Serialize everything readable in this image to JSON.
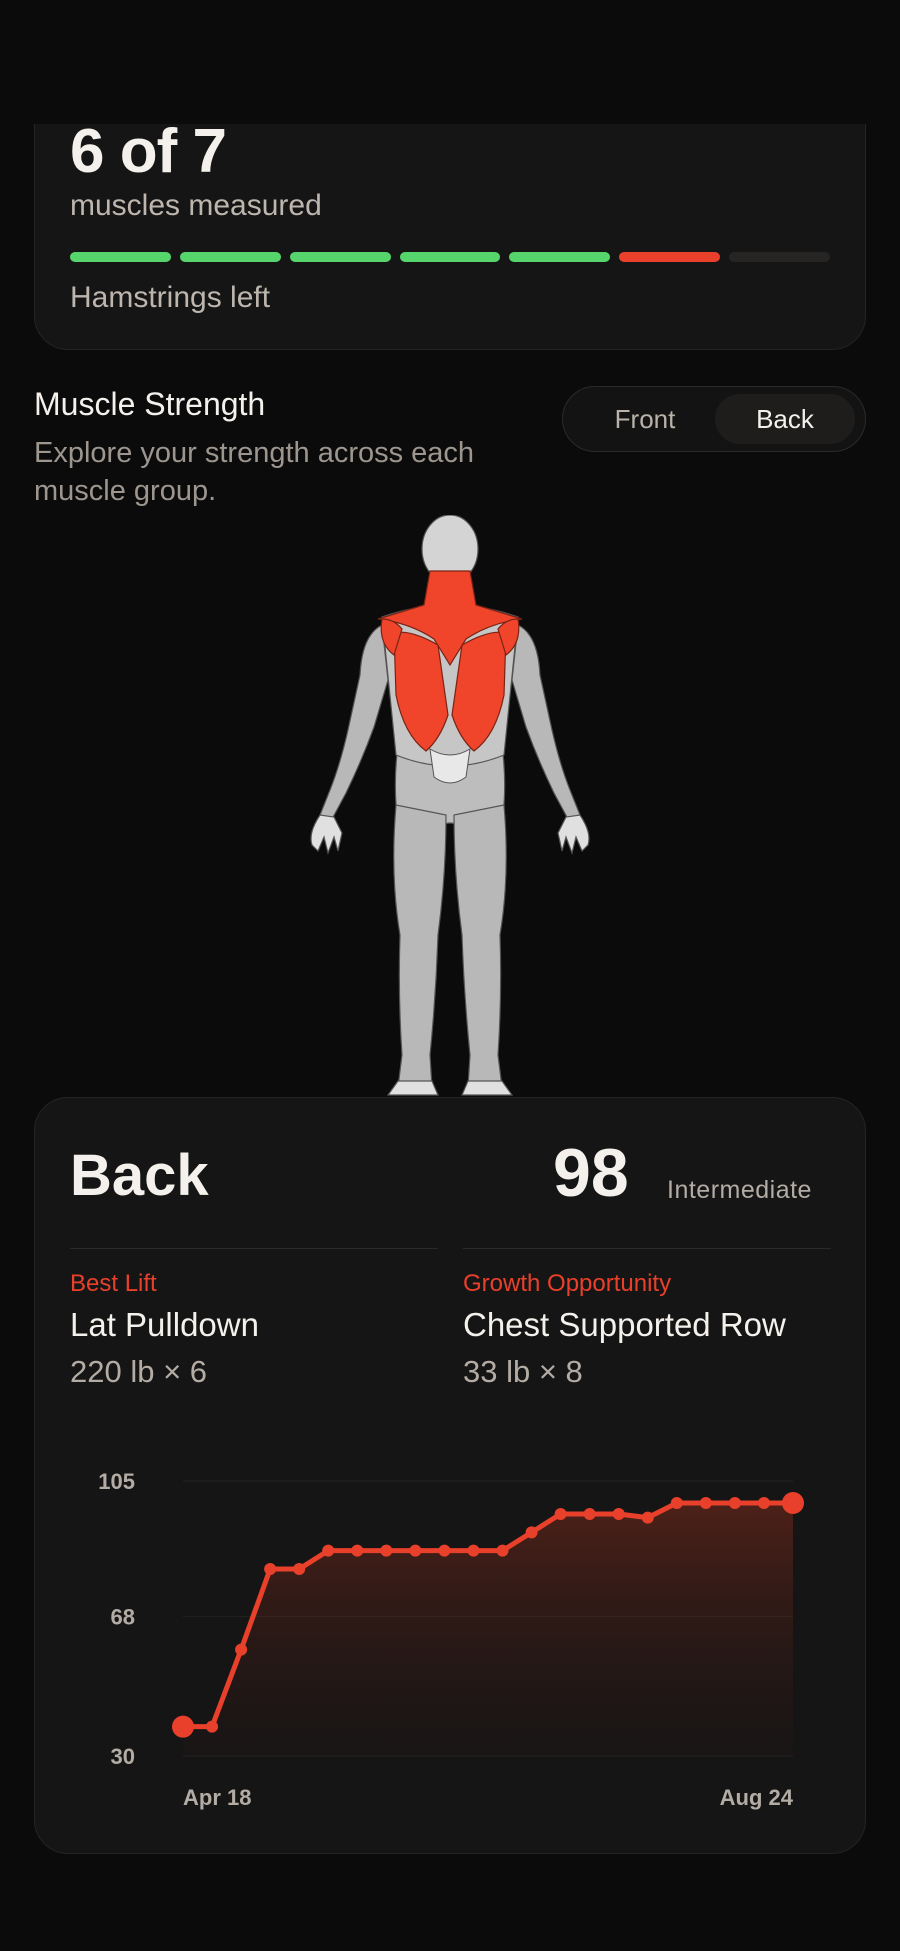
{
  "progress": {
    "count": "6 of 7",
    "label": "muscles measured",
    "remaining": "Hamstrings left",
    "segments": [
      "complete",
      "complete",
      "complete",
      "complete",
      "complete",
      "current",
      "empty"
    ],
    "colors": {
      "complete": "#56d56d",
      "current": "#e8402a",
      "empty": "#262524"
    }
  },
  "strength": {
    "title": "Muscle Strength",
    "subtitle": "Explore your strength across each muscle group.",
    "view_options": [
      "Front",
      "Back"
    ],
    "selected_view": "Back"
  },
  "figure": {
    "highlighted_group": "Back",
    "highlight_color": "#f0452a"
  },
  "detail": {
    "group": "Back",
    "score": "98",
    "level": "Intermediate",
    "best_lift": {
      "label": "Best Lift",
      "exercise": "Lat Pulldown",
      "value": "220 lb × 6"
    },
    "growth": {
      "label": "Growth Opportunity",
      "exercise": "Chest Supported Row",
      "value": "33 lb × 8"
    }
  },
  "chart_data": {
    "type": "area",
    "y_ticks": [
      "105",
      "68",
      "30"
    ],
    "ylim": [
      30,
      105
    ],
    "x_labels": [
      "Apr 18",
      "Aug 24"
    ],
    "series": [
      {
        "values": [
          38,
          38,
          59,
          81,
          81,
          86,
          86,
          86,
          86,
          86,
          86,
          86,
          91,
          96,
          96,
          96,
          95,
          99,
          99,
          99,
          99,
          99
        ]
      }
    ],
    "grid": true,
    "color": "#e8402a"
  }
}
